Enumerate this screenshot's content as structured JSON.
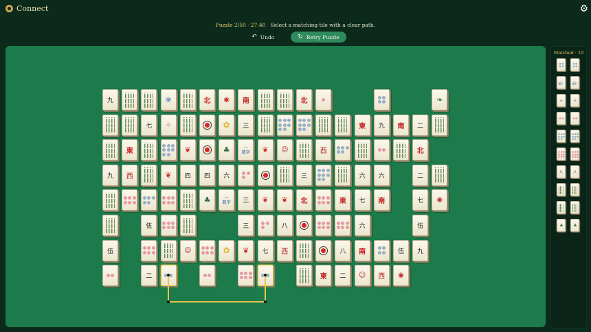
{
  "app": {
    "title": "Connect"
  },
  "status": {
    "puzzle": "Puzzle 2/50",
    "sep": " · ",
    "time": "27:40",
    "message": "Select a matching tile with a clear path."
  },
  "controls": {
    "undo": "Undo",
    "retry": "Retry Puzzle"
  },
  "matched": {
    "label": "Matched · 10"
  },
  "board": {
    "tiles": [
      {
        "r": 0,
        "c": 0,
        "g": "char",
        "t": "九"
      },
      {
        "r": 0,
        "c": 1,
        "g": "bam"
      },
      {
        "r": 0,
        "c": 2,
        "g": "bam"
      },
      {
        "r": 0,
        "c": 3,
        "g": "butterfly"
      },
      {
        "r": 0,
        "c": 4,
        "g": "bam"
      },
      {
        "r": 0,
        "c": 5,
        "g": "wind",
        "t": "北"
      },
      {
        "r": 0,
        "c": 6,
        "g": "lantern"
      },
      {
        "r": 0,
        "c": 7,
        "g": "wind",
        "t": "南"
      },
      {
        "r": 0,
        "c": 8,
        "g": "bam"
      },
      {
        "r": 0,
        "c": 9,
        "g": "bam"
      },
      {
        "r": 0,
        "c": 10,
        "g": "wind",
        "t": "北"
      },
      {
        "r": 0,
        "c": 11,
        "g": "dots",
        "n": 1,
        "col": "red"
      },
      {
        "r": 0,
        "c": 14,
        "g": "dots",
        "n": 4,
        "col": "blue"
      },
      {
        "r": 0,
        "c": 17,
        "g": "leaf"
      },
      {
        "r": 1,
        "c": 0,
        "g": "bam"
      },
      {
        "r": 1,
        "c": 1,
        "g": "bam"
      },
      {
        "r": 1,
        "c": 2,
        "g": "char",
        "t": "七"
      },
      {
        "r": 1,
        "c": 3,
        "g": "twig"
      },
      {
        "r": 1,
        "c": 4,
        "g": "bam"
      },
      {
        "r": 1,
        "c": 5,
        "g": "dragon"
      },
      {
        "r": 1,
        "c": 6,
        "g": "flower"
      },
      {
        "r": 1,
        "c": 7,
        "g": "char",
        "t": "三"
      },
      {
        "r": 1,
        "c": 8,
        "g": "bam"
      },
      {
        "r": 1,
        "c": 9,
        "g": "dots",
        "n": 8,
        "col": "blue"
      },
      {
        "r": 1,
        "c": 10,
        "g": "dots",
        "n": 8,
        "col": "blue"
      },
      {
        "r": 1,
        "c": 11,
        "g": "bam"
      },
      {
        "r": 1,
        "c": 12,
        "g": "bam"
      },
      {
        "r": 1,
        "c": 13,
        "g": "wind",
        "t": "東"
      },
      {
        "r": 1,
        "c": 14,
        "g": "char",
        "t": "九"
      },
      {
        "r": 1,
        "c": 15,
        "g": "wind",
        "t": "南"
      },
      {
        "r": 1,
        "c": 16,
        "g": "char",
        "t": "二"
      },
      {
        "r": 1,
        "c": 17,
        "g": "bam"
      },
      {
        "r": 2,
        "c": 0,
        "g": "bam"
      },
      {
        "r": 2,
        "c": 1,
        "g": "wind",
        "t": "東"
      },
      {
        "r": 2,
        "c": 2,
        "g": "bam"
      },
      {
        "r": 2,
        "c": 3,
        "g": "dots",
        "n": 8,
        "col": "blue"
      },
      {
        "r": 2,
        "c": 4,
        "g": "koi"
      },
      {
        "r": 2,
        "c": 5,
        "g": "dragon"
      },
      {
        "r": 2,
        "c": 6,
        "g": "bird"
      },
      {
        "r": 2,
        "c": 7,
        "g": "kanji",
        "t": "一数字"
      },
      {
        "r": 2,
        "c": 8,
        "g": "koi"
      },
      {
        "r": 2,
        "c": 9,
        "g": "cat"
      },
      {
        "r": 2,
        "c": 10,
        "g": "bam"
      },
      {
        "r": 2,
        "c": 11,
        "g": "west",
        "t": "西"
      },
      {
        "r": 2,
        "c": 12,
        "g": "dots",
        "n": 5,
        "col": "blue"
      },
      {
        "r": 2,
        "c": 13,
        "g": "bam"
      },
      {
        "r": 2,
        "c": 14,
        "g": "dots",
        "n": 2,
        "col": "red"
      },
      {
        "r": 2,
        "c": 15,
        "g": "bam"
      },
      {
        "r": 2,
        "c": 16,
        "g": "wind",
        "t": "北"
      },
      {
        "r": 3,
        "c": 0,
        "g": "char",
        "t": "九"
      },
      {
        "r": 3,
        "c": 1,
        "g": "west",
        "t": "西"
      },
      {
        "r": 3,
        "c": 2,
        "g": "bam"
      },
      {
        "r": 3,
        "c": 3,
        "g": "koi"
      },
      {
        "r": 3,
        "c": 4,
        "g": "char",
        "t": "四"
      },
      {
        "r": 3,
        "c": 5,
        "g": "char",
        "t": "四"
      },
      {
        "r": 3,
        "c": 6,
        "g": "char",
        "t": "六"
      },
      {
        "r": 3,
        "c": 7,
        "g": "dots",
        "n": 3,
        "col": "red"
      },
      {
        "r": 3,
        "c": 8,
        "g": "dragon"
      },
      {
        "r": 3,
        "c": 9,
        "g": "bam"
      },
      {
        "r": 3,
        "c": 10,
        "g": "char",
        "t": "三"
      },
      {
        "r": 3,
        "c": 11,
        "g": "dots",
        "n": 8,
        "col": "blue"
      },
      {
        "r": 3,
        "c": 12,
        "g": "bam"
      },
      {
        "r": 3,
        "c": 13,
        "g": "char",
        "t": "六"
      },
      {
        "r": 3,
        "c": 14,
        "g": "char",
        "t": "六"
      },
      {
        "r": 3,
        "c": 16,
        "g": "char",
        "t": "二"
      },
      {
        "r": 3,
        "c": 17,
        "g": "bam"
      },
      {
        "r": 4,
        "c": 0,
        "g": "bam"
      },
      {
        "r": 4,
        "c": 1,
        "g": "dots",
        "n": 6,
        "col": "red"
      },
      {
        "r": 4,
        "c": 2,
        "g": "dots",
        "n": 5,
        "col": "blue"
      },
      {
        "r": 4,
        "c": 3,
        "g": "dots",
        "n": 6,
        "col": "red"
      },
      {
        "r": 4,
        "c": 4,
        "g": "bam"
      },
      {
        "r": 4,
        "c": 5,
        "g": "bird"
      },
      {
        "r": 4,
        "c": 6,
        "g": "kanji",
        "t": "一数字"
      },
      {
        "r": 4,
        "c": 7,
        "g": "char",
        "t": "三"
      },
      {
        "r": 4,
        "c": 8,
        "g": "koi"
      },
      {
        "r": 4,
        "c": 9,
        "g": "koi"
      },
      {
        "r": 4,
        "c": 10,
        "g": "wind",
        "t": "北"
      },
      {
        "r": 4,
        "c": 11,
        "g": "dots",
        "n": 6,
        "col": "red"
      },
      {
        "r": 4,
        "c": 12,
        "g": "wind",
        "t": "東"
      },
      {
        "r": 4,
        "c": 13,
        "g": "char",
        "t": "七"
      },
      {
        "r": 4,
        "c": 14,
        "g": "wind",
        "t": "南"
      },
      {
        "r": 4,
        "c": 16,
        "g": "char",
        "t": "七"
      },
      {
        "r": 4,
        "c": 17,
        "g": "lantern"
      },
      {
        "r": 5,
        "c": 0,
        "g": "bam"
      },
      {
        "r": 5,
        "c": 2,
        "g": "char",
        "t": "伍"
      },
      {
        "r": 5,
        "c": 3,
        "g": "dots",
        "n": 6,
        "col": "red"
      },
      {
        "r": 5,
        "c": 4,
        "g": "bam"
      },
      {
        "r": 5,
        "c": 7,
        "g": "char",
        "t": "三"
      },
      {
        "r": 5,
        "c": 8,
        "g": "dots",
        "n": 3,
        "col": "red"
      },
      {
        "r": 5,
        "c": 9,
        "g": "char",
        "t": "八"
      },
      {
        "r": 5,
        "c": 10,
        "g": "dragon"
      },
      {
        "r": 5,
        "c": 11,
        "g": "dots",
        "n": 6,
        "col": "red"
      },
      {
        "r": 5,
        "c": 12,
        "g": "dots",
        "n": 6,
        "col": "red"
      },
      {
        "r": 5,
        "c": 13,
        "g": "char",
        "t": "六"
      },
      {
        "r": 5,
        "c": 16,
        "g": "char",
        "t": "伍"
      },
      {
        "r": 6,
        "c": 0,
        "g": "char",
        "t": "伍"
      },
      {
        "r": 6,
        "c": 2,
        "g": "dots",
        "n": 6,
        "col": "red"
      },
      {
        "r": 6,
        "c": 3,
        "g": "bam"
      },
      {
        "r": 6,
        "c": 4,
        "g": "cat"
      },
      {
        "r": 6,
        "c": 5,
        "g": "dots",
        "n": 6,
        "col": "red"
      },
      {
        "r": 6,
        "c": 6,
        "g": "flower"
      },
      {
        "r": 6,
        "c": 7,
        "g": "koi"
      },
      {
        "r": 6,
        "c": 8,
        "g": "char",
        "t": "七"
      },
      {
        "r": 6,
        "c": 9,
        "g": "west",
        "t": "西"
      },
      {
        "r": 6,
        "c": 10,
        "g": "bam"
      },
      {
        "r": 6,
        "c": 11,
        "g": "dragon"
      },
      {
        "r": 6,
        "c": 12,
        "g": "char",
        "t": "八"
      },
      {
        "r": 6,
        "c": 13,
        "g": "wind",
        "t": "南"
      },
      {
        "r": 6,
        "c": 14,
        "g": "dots",
        "n": 4,
        "col": "blue"
      },
      {
        "r": 6,
        "c": 15,
        "g": "char",
        "t": "伍"
      },
      {
        "r": 6,
        "c": 16,
        "g": "char",
        "t": "九"
      },
      {
        "r": 7,
        "c": 0,
        "g": "dots",
        "n": 2,
        "col": "red"
      },
      {
        "r": 7,
        "c": 2,
        "g": "char",
        "t": "二"
      },
      {
        "r": 7,
        "c": 3,
        "g": "dots",
        "n": 2,
        "col": "blue",
        "sel": true
      },
      {
        "r": 7,
        "c": 5,
        "g": "dots",
        "n": 2,
        "col": "red"
      },
      {
        "r": 7,
        "c": 7,
        "g": "dots",
        "n": 6,
        "col": "red"
      },
      {
        "r": 7,
        "c": 8,
        "g": "dots",
        "n": 2,
        "col": "blue",
        "sel": true
      },
      {
        "r": 7,
        "c": 10,
        "g": "bam"
      },
      {
        "r": 7,
        "c": 11,
        "g": "wind",
        "t": "東"
      },
      {
        "r": 7,
        "c": 12,
        "g": "char",
        "t": "二"
      },
      {
        "r": 7,
        "c": 13,
        "g": "cat"
      },
      {
        "r": 7,
        "c": 14,
        "g": "west",
        "t": "西"
      },
      {
        "r": 7,
        "c": 15,
        "g": "lantern"
      }
    ]
  },
  "matched_tiles": [
    {
      "g": "dots",
      "n": 4,
      "col": "blue"
    },
    {
      "g": "dots",
      "n": 4,
      "col": "blue"
    },
    {
      "g": "kanji",
      "t": "一数字"
    },
    {
      "g": "kanji",
      "t": "一数字"
    },
    {
      "g": "char",
      "t": "∞"
    },
    {
      "g": "char",
      "t": "∞"
    },
    {
      "g": "dots",
      "n": 2,
      "col": "red"
    },
    {
      "g": "dots",
      "n": 2,
      "col": "red"
    },
    {
      "g": "dots",
      "n": 8,
      "col": "blue"
    },
    {
      "g": "dots",
      "n": 8,
      "col": "blue"
    },
    {
      "g": "dots",
      "n": 9,
      "col": "red"
    },
    {
      "g": "dots",
      "n": 9,
      "col": "red"
    },
    {
      "g": "char",
      "t": "八"
    },
    {
      "g": "char",
      "t": "八"
    },
    {
      "g": "bam"
    },
    {
      "g": "bam"
    },
    {
      "g": "bam"
    },
    {
      "g": "bam"
    },
    {
      "g": "bird"
    },
    {
      "g": "bird"
    }
  ],
  "icons": {
    "logo": "connect-logo-icon",
    "settings": "gear-icon",
    "undo": "undo-icon",
    "retry": "retry-icon"
  },
  "colors": {
    "board": "#1d7a4a",
    "background": "#0b2a1c",
    "accent": "#e5c54e",
    "retry": "#2f8a5c"
  }
}
